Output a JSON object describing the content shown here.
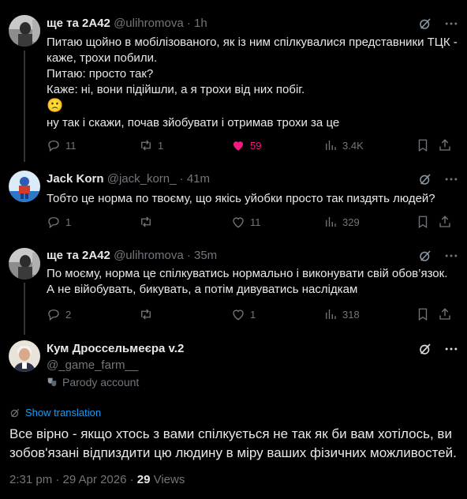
{
  "tweets": [
    {
      "name": "ще та 2А42",
      "handle": "@ulihromova",
      "time": "1h",
      "lines": [
        "Питаю щойно в мобілізованого, як із ним спілкувалися представники ТЦК -",
        "каже, трохи побили.",
        "Питаю: просто так?",
        "Каже: ні, вони підійшли, а я трохи від них побіг.",
        "ну так і скажи, почав зйобувати і отримав трохи за це"
      ],
      "emoji": "🙁",
      "replies": "11",
      "reposts": "1",
      "likes": "59",
      "views": "3.4K"
    },
    {
      "name": "Jack Korn",
      "handle": "@jack_korn_",
      "time": "41m",
      "lines": [
        "Тобто це норма по твоєму, що якісь уйобки просто так пиздять людей?"
      ],
      "replies": "1",
      "reposts": "",
      "likes": "11",
      "views": "329"
    },
    {
      "name": "ще та 2А42",
      "handle": "@ulihromova",
      "time": "35m",
      "lines": [
        "По моєму, норма це спілкуватись нормально і виконувати свій обов’язок.",
        "А не війобувать, бикувать, а потім дивуватись наслідкам"
      ],
      "replies": "2",
      "reposts": "",
      "likes": "1",
      "views": "318"
    }
  ],
  "main": {
    "name": "Кум Дроссельмеєра v.2",
    "handle": "@_game_farm__",
    "parody_label": "Parody account",
    "show_translation": "Show translation",
    "lines": [
      "Все вірно - якщо хтось з вами спілкується не так як би вам хотілось, ви",
      "зобов'язані відпиздити цю людину в міру ваших фізичних можливостей."
    ],
    "timestamp": "2:31 pm · 29 Apr 2026 · ",
    "views_count": "29",
    "views_label": " Views"
  },
  "colors": {
    "background": "#000000",
    "text": "#e7e9ea",
    "secondary": "#71767b",
    "like": "#f91880",
    "link": "#1d9bf0",
    "separator": "#2f3336"
  }
}
